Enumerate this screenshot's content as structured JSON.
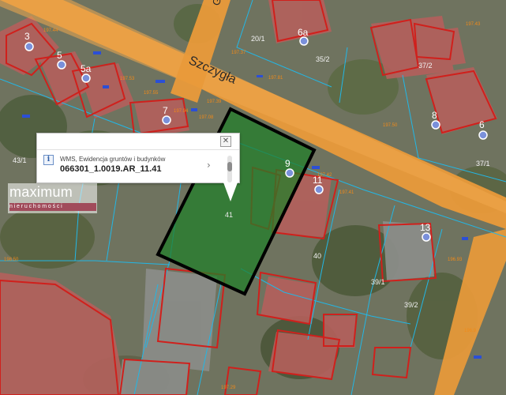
{
  "map": {
    "street_name": "Szczygła",
    "street_edge_letter": "G",
    "plot_number": "41",
    "parcel_labels": [
      "43/1",
      "40",
      "39/1",
      "39/2",
      "37/2",
      "37/1",
      "20/1",
      "35/2"
    ],
    "address_markers": [
      "3",
      "5",
      "5a",
      "7",
      "6a",
      "8",
      "6",
      "9",
      "11",
      "13"
    ],
    "elevations": [
      "197.53",
      "197.55",
      "197.41",
      "197.37",
      "197.42",
      "197.50",
      "196.93",
      "196.9",
      "197.08",
      "197.44",
      "197.81",
      "197.94",
      "197.39",
      "197.29",
      "198.50",
      "197.43"
    ],
    "colors": {
      "street": "#e99a3a",
      "parcel_line": "#22b7e6",
      "building_outline": "#d0201c",
      "selected_parcel": "#1f7e28",
      "marker": "#6b87d6"
    }
  },
  "popup": {
    "close_label": "✕",
    "info_glyph": "i",
    "layer_name": "WMS, Ewidencja gruntów i budynków",
    "parcel_id": "066301_1.0019.AR_11.41",
    "chevron": "›"
  },
  "watermark": {
    "brand": "maximum",
    "subtitle": "nieruchomości"
  }
}
